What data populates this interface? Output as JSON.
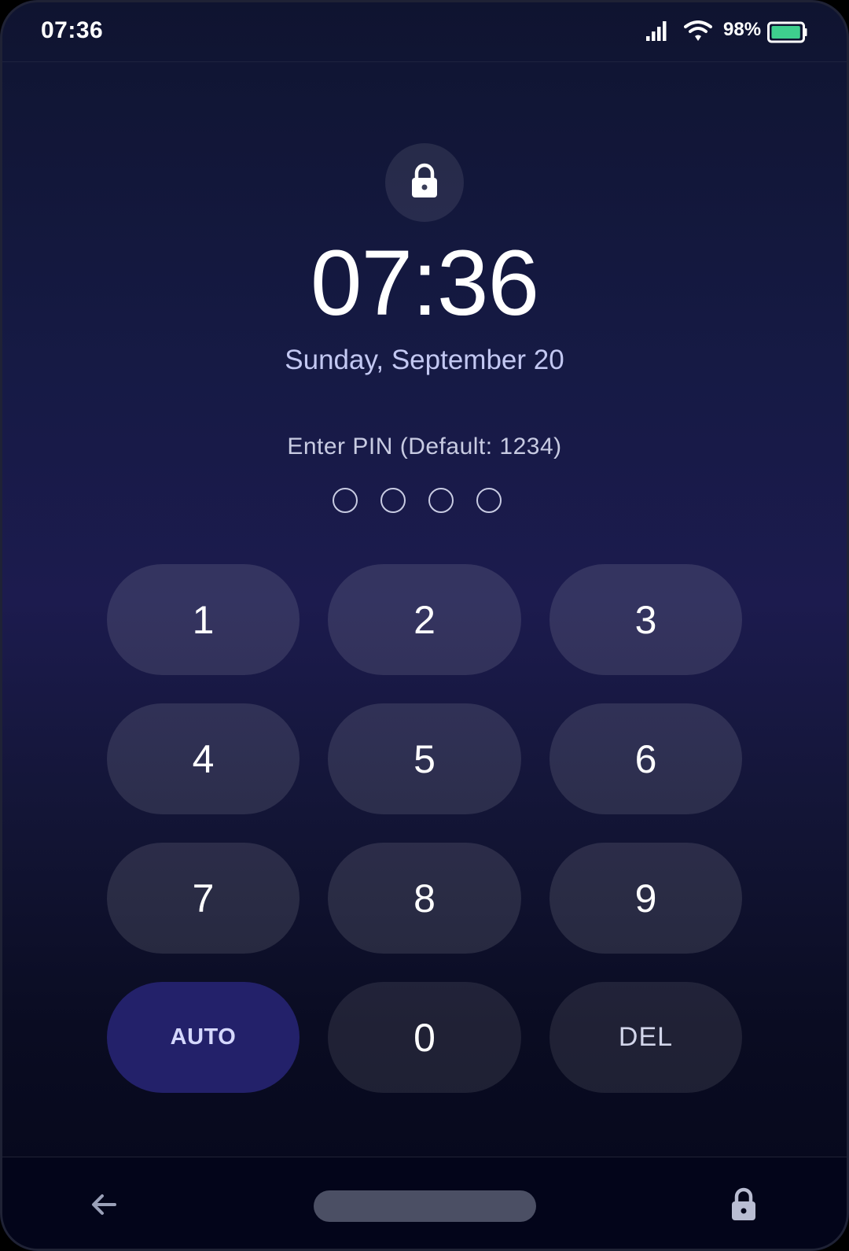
{
  "status_bar": {
    "time": "07:36",
    "battery_percent": "98%",
    "battery_level": 0.98,
    "battery_color": "#3ecf8e",
    "icons": [
      "signal-icon",
      "wifi-icon",
      "battery-icon"
    ]
  },
  "lock_screen": {
    "lock_icon": "lock-icon",
    "time": "07:36",
    "date": "Sunday, September 20",
    "pin_prompt": "Enter PIN (Default: 1234)",
    "pin_length": 4,
    "pin_entered": 0
  },
  "keypad": {
    "keys": [
      {
        "label": "1",
        "type": "digit"
      },
      {
        "label": "2",
        "type": "digit"
      },
      {
        "label": "3",
        "type": "digit"
      },
      {
        "label": "4",
        "type": "digit"
      },
      {
        "label": "5",
        "type": "digit"
      },
      {
        "label": "6",
        "type": "digit"
      },
      {
        "label": "7",
        "type": "digit"
      },
      {
        "label": "8",
        "type": "digit"
      },
      {
        "label": "9",
        "type": "digit"
      },
      {
        "label": "AUTO",
        "type": "auto"
      },
      {
        "label": "0",
        "type": "zero"
      },
      {
        "label": "DEL",
        "type": "del"
      }
    ],
    "auto_color": "#23216a"
  },
  "nav_bar": {
    "icons": [
      "back-arrow-icon",
      "home-pill",
      "lock-icon"
    ]
  }
}
